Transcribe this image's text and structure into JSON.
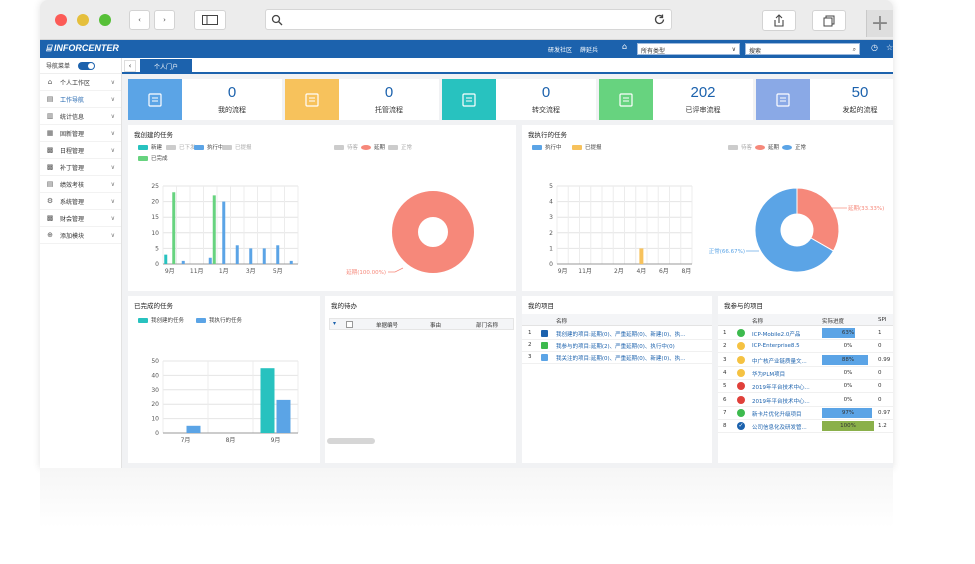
{
  "app": {
    "brand": "INFORCENTER"
  },
  "header": {
    "links": [
      "研发社区",
      "薛延兵"
    ],
    "type_select": "所有类型",
    "search_placeholder": "搜索"
  },
  "sidebar": {
    "nav_label": "导航菜单",
    "items": [
      {
        "label": "个人工作区",
        "icon": "home-icon"
      },
      {
        "label": "工作导航",
        "icon": "folder-icon"
      },
      {
        "label": "统计信息",
        "icon": "chart-icon"
      },
      {
        "label": "固新管理",
        "icon": "calendar-icon"
      },
      {
        "label": "日程管理",
        "icon": "grid-icon"
      },
      {
        "label": "补丁管理",
        "icon": "grid-icon"
      },
      {
        "label": "绩效考核",
        "icon": "folder-icon"
      },
      {
        "label": "系统管理",
        "icon": "gear-icon"
      },
      {
        "label": "财会管理",
        "icon": "grid-icon"
      },
      {
        "label": "添加模块",
        "icon": "plus-circle-icon"
      }
    ]
  },
  "tabs": {
    "active": "个人门户"
  },
  "stats": [
    {
      "value": "0",
      "label": "我的流程",
      "color": "#5ba4e6"
    },
    {
      "value": "0",
      "label": "托管流程",
      "color": "#f7c25c"
    },
    {
      "value": "0",
      "label": "转交流程",
      "color": "#28c2bf"
    },
    {
      "value": "202",
      "label": "已评审流程",
      "color": "#67d37f"
    },
    {
      "value": "50",
      "label": "发起的流程",
      "color": "#8aa9e6"
    }
  ],
  "panels": {
    "created_tasks": {
      "title": "我创建的任务",
      "legend": [
        "新建",
        "已下发",
        "执行中",
        "已提报",
        "已完成"
      ],
      "pie_legend": [
        "待客",
        "延期",
        "正常"
      ]
    },
    "executed_tasks": {
      "title": "我执行的任务",
      "legend": [
        "执行中",
        "已提报"
      ],
      "pie_legend": [
        "待客",
        "延期",
        "正常"
      ]
    },
    "completed_tasks": {
      "title": "已完成的任务",
      "legend": [
        "我创建的任务",
        "我执行的任务"
      ]
    },
    "todo": {
      "title": "我的待办",
      "columns": [
        "单据编号",
        "事由",
        "部门名称"
      ]
    },
    "projects": {
      "title": "我的项目",
      "column": "名称",
      "rows": [
        {
          "no": "1",
          "text": "我创建的项目:延期(0)、严重延期(0)、新建(0)、执..."
        },
        {
          "no": "2",
          "text": "我参与的项目:延期(2)、严重延期(0)、执行中(0)"
        },
        {
          "no": "3",
          "text": "我关注的项目:延期(0)、严重延期(0)、新建(0)、执..."
        }
      ]
    },
    "involved": {
      "title": "我参与的项目",
      "columns": [
        "名称",
        "实际进度",
        "SPI"
      ],
      "rows": [
        {
          "no": "1",
          "name": "ICP-Mobile2.0产品",
          "progress": "63%",
          "spi": "1",
          "status": "#3dba4e"
        },
        {
          "no": "2",
          "name": "ICP-Enterprise8.5",
          "progress": "0%",
          "spi": "0",
          "status": "#f5c242"
        },
        {
          "no": "3",
          "name": "中广核产业链质量文...",
          "progress": "88%",
          "spi": "0.99",
          "status": "#f5c242"
        },
        {
          "no": "4",
          "name": "华为PLM项目",
          "progress": "0%",
          "spi": "0",
          "status": "#f5c242"
        },
        {
          "no": "5",
          "name": "2019年平台技术中心...",
          "progress": "0%",
          "spi": "0",
          "status": "#e0403a"
        },
        {
          "no": "6",
          "name": "2019年平台技术中心...",
          "progress": "0%",
          "spi": "0",
          "status": "#e0403a"
        },
        {
          "no": "7",
          "name": "新卡片优化升级项目",
          "progress": "97%",
          "spi": "0.97",
          "status": "#3dba4e"
        },
        {
          "no": "8",
          "name": "公司信息化及研发管...",
          "progress": "100%",
          "spi": "1.2",
          "status": "#1c62ad"
        }
      ]
    }
  },
  "chart_data": [
    {
      "type": "bar",
      "categories": [
        "9月",
        "10月",
        "11月",
        "12月",
        "1月",
        "2月",
        "3月",
        "4月",
        "5月",
        "6月"
      ],
      "series": [
        {
          "name": "新建",
          "color": "#28c2bf",
          "values": [
            3,
            0,
            0,
            0,
            0,
            0,
            0,
            0,
            0,
            0
          ]
        },
        {
          "name": "已下发",
          "color": "#cccccc",
          "values": [
            0,
            0,
            0,
            0,
            0,
            0,
            0,
            0,
            0,
            0
          ]
        },
        {
          "name": "执行中",
          "color": "#5ba4e6",
          "values": [
            0,
            1,
            0,
            2,
            20,
            6,
            5,
            5,
            6,
            1
          ]
        },
        {
          "name": "已提报",
          "color": "#cccccc",
          "values": [
            0,
            0,
            0,
            0,
            0,
            0,
            0,
            0,
            0,
            0
          ]
        },
        {
          "name": "已完成",
          "color": "#67d37f",
          "values": [
            23,
            0,
            0,
            22,
            0,
            0,
            0,
            0,
            0,
            0
          ]
        }
      ],
      "xticks": [
        "9月",
        "11月",
        "1月",
        "3月",
        "5月"
      ],
      "yticks": [
        0,
        5,
        10,
        15,
        20,
        25
      ],
      "ylim": [
        0,
        25
      ]
    },
    {
      "type": "pie",
      "labels": [
        "延期"
      ],
      "values": [
        100
      ],
      "colors": [
        "#f6887a"
      ],
      "data_labels": [
        "延期(100.00%)"
      ]
    },
    {
      "type": "bar",
      "categories": [
        "9月",
        "10月",
        "11月",
        "12月",
        "1月",
        "2月",
        "3月",
        "4月",
        "5月",
        "6月",
        "7月",
        "8月"
      ],
      "series": [
        {
          "name": "执行中",
          "color": "#5ba4e6",
          "values": [
            0,
            0,
            0,
            0,
            0,
            0,
            0,
            0,
            0,
            0,
            0,
            0
          ]
        },
        {
          "name": "已提报",
          "color": "#f7c25c",
          "values": [
            0,
            0,
            0,
            0,
            0,
            0,
            0,
            1,
            0,
            0,
            0,
            0
          ]
        }
      ],
      "xticks": [
        "9月",
        "11月",
        "2月",
        "4月",
        "6月",
        "8月"
      ],
      "yticks": [
        0,
        1,
        2,
        3,
        4,
        5
      ],
      "ylim": [
        0,
        5
      ]
    },
    {
      "type": "pie",
      "labels": [
        "延期",
        "正常"
      ],
      "values": [
        33.33,
        66.67
      ],
      "colors": [
        "#f6887a",
        "#5ba4e6"
      ],
      "data_labels": [
        "延期(33.33%)",
        "正常(66.67%)"
      ]
    },
    {
      "type": "bar",
      "categories": [
        "7月",
        "8月",
        "9月"
      ],
      "series": [
        {
          "name": "我创建的任务",
          "color": "#28c2bf",
          "values": [
            0,
            0,
            45
          ]
        },
        {
          "name": "我执行的任务",
          "color": "#5ba4e6",
          "values": [
            5,
            0,
            23
          ]
        }
      ],
      "xticks": [
        "7月",
        "8月",
        "9月"
      ],
      "yticks": [
        0,
        10,
        20,
        30,
        40,
        50
      ],
      "ylim": [
        0,
        50
      ]
    }
  ]
}
